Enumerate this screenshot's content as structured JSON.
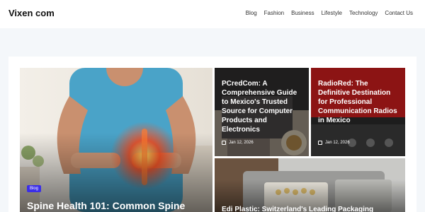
{
  "site": {
    "title": "Vixen com"
  },
  "nav": [
    "Blog",
    "Fashion",
    "Business",
    "Lifestyle",
    "Technology",
    "Contact Us"
  ],
  "cards": [
    {
      "title": "Spine Health 101: Common Spine",
      "badge": "Blog"
    },
    {
      "title": "PCredCom: A Comprehensive Guide to Mexico's Trusted Source for Computer Products and Electronics",
      "date": "Jan 12, 2026"
    },
    {
      "title": "RadioRed: The Definitive Destination for Professional Communication Radios in Mexico",
      "date": "Jan 12, 2026"
    },
    {
      "title": "Edi Plastic: Switzerland's Leading Packaging"
    }
  ],
  "icons": {
    "date": "calendar-icon"
  },
  "colors": {
    "header_bg": "#ffffff",
    "page_bg": "#f4f7fa",
    "badge_bg": "#3b2ee8",
    "title_text": "#ffffff"
  }
}
